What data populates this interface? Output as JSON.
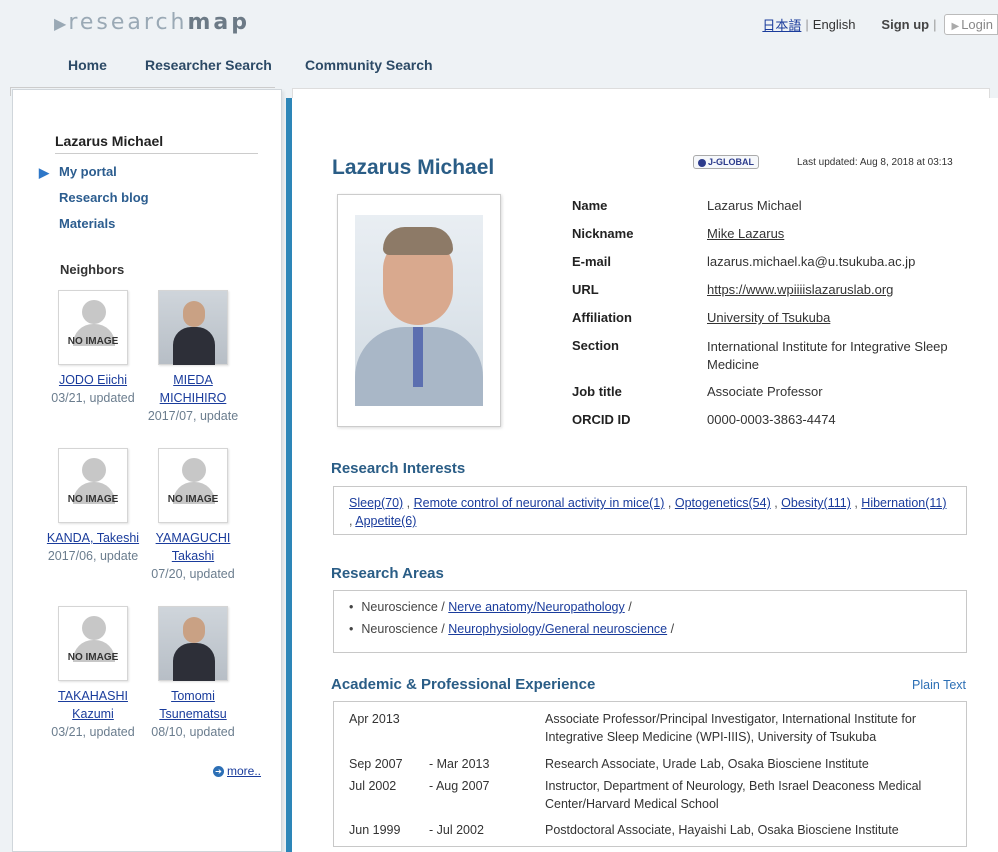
{
  "header": {
    "logo_prefix": "research",
    "logo_bold": "map",
    "lang_ja": "日本語",
    "lang_en": "English",
    "signup": "Sign up",
    "login": "Login"
  },
  "nav": {
    "home": "Home",
    "researcher_search": "Researcher Search",
    "community_search": "Community Search"
  },
  "sidebar": {
    "title": "Lazarus Michael",
    "links": [
      "My portal",
      "Research blog",
      "Materials"
    ],
    "neighbors_title": "Neighbors",
    "no_image": "NO IMAGE",
    "neighbors": [
      {
        "name": "JODO Eiichi",
        "updated": "03/21, updated",
        "photo": "no-image"
      },
      {
        "name": "MIEDA MICHIHIRO",
        "updated": "2017/07, update",
        "photo": "portrait"
      },
      {
        "name": "KANDA, Takeshi",
        "updated": "2017/06, update",
        "photo": "no-image"
      },
      {
        "name": "YAMAGUCHI Takashi",
        "updated": "07/20, updated",
        "photo": "no-image"
      },
      {
        "name": "TAKAHASHI Kazumi",
        "updated": "03/21, updated",
        "photo": "no-image"
      },
      {
        "name": "Tomomi Tsunematsu",
        "updated": "08/10, updated",
        "photo": "portrait"
      }
    ],
    "more": "more.."
  },
  "profile": {
    "name": "Lazarus Michael",
    "jglobal": "J-GLOBAL",
    "last_updated": "Last updated: Aug 8, 2018 at 03:13",
    "fields": [
      {
        "label": "Name",
        "value": "Lazarus Michael",
        "link": false
      },
      {
        "label": "Nickname",
        "value": "Mike Lazarus",
        "link": true
      },
      {
        "label": "E-mail",
        "value": "lazarus.michael.ka@u.tsukuba.ac.jp",
        "link": false
      },
      {
        "label": "URL",
        "value": "https://www.wpiiiislazaruslab.org",
        "link": true
      },
      {
        "label": "Affiliation",
        "value": "University of Tsukuba",
        "link": true
      },
      {
        "label": "Section",
        "value": "International Institute for Integrative Sleep Medicine",
        "link": false
      },
      {
        "label": "Job title",
        "value": "Associate Professor",
        "link": false
      },
      {
        "label": "ORCID ID",
        "value": "0000-0003-3863-4474",
        "link": false
      }
    ]
  },
  "research_interests": {
    "title": "Research Interests",
    "items": [
      "Sleep(70)",
      "Remote control of neuronal activity in mice(1)",
      "Optogenetics(54)",
      "Obesity(111)",
      "Hibernation(11)",
      "Appetite(6)"
    ]
  },
  "research_areas": {
    "title": "Research Areas",
    "items": [
      {
        "field": "Neuroscience",
        "topic": "Nerve anatomy/Neuropathology"
      },
      {
        "field": "Neuroscience",
        "topic": "Neurophysiology/General neuroscience"
      }
    ]
  },
  "experience": {
    "title": "Academic & Professional Experience",
    "plain_text": "Plain Text",
    "rows": [
      {
        "from": "Apr 2013",
        "to": "",
        "desc": "Associate Professor/Principal Investigator, International Institute for Integrative Sleep Medicine (WPI-IIIS), University of Tsukuba"
      },
      {
        "from": "Sep 2007",
        "to": "- Mar 2013",
        "desc": "Research Associate, Urade Lab, Osaka Biosciene Institute"
      },
      {
        "from": "Jul 2002",
        "to": "- Aug 2007",
        "desc": "Instructor, Department of Neurology, Beth Israel Deaconess Medical Center/Harvard Medical School"
      },
      {
        "from": "Jun 1999",
        "to": "- Jul 2002",
        "desc": "Postdoctoral Associate, Hayaishi Lab, Osaka Biosciene Institute"
      }
    ]
  }
}
